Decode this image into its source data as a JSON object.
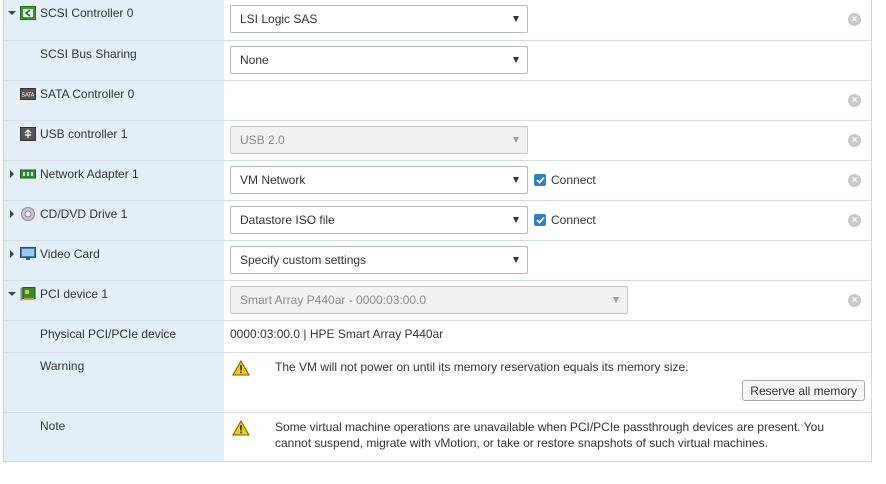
{
  "rows": {
    "scsi": {
      "label": "SCSI Controller 0",
      "value": "LSI Logic SAS"
    },
    "scsi_bus": {
      "label": "SCSI Bus Sharing",
      "value": "None"
    },
    "sata": {
      "label": "SATA Controller 0"
    },
    "usb": {
      "label": "USB controller 1",
      "value": "USB 2.0"
    },
    "net": {
      "label": "Network Adapter 1",
      "value": "VM Network",
      "connect_label": "Connect"
    },
    "cd": {
      "label": "CD/DVD Drive 1",
      "value": "Datastore ISO file",
      "connect_label": "Connect"
    },
    "video": {
      "label": "Video Card",
      "value": "Specify custom settings"
    },
    "pci": {
      "label": "PCI device 1",
      "value": "Smart Array P440ar - 0000:03:00.0"
    },
    "physical": {
      "label": "Physical PCI/PCIe device",
      "value": "0000:03:00.0 | HPE Smart Array P440ar"
    },
    "warning": {
      "label": "Warning",
      "text": "The VM will not power on until its memory reservation equals its memory size.",
      "button": "Reserve all memory"
    },
    "note": {
      "label": "Note",
      "text": "Some virtual machine operations are unavailable when PCI/PCIe passthrough devices are present. You cannot suspend, migrate with vMotion, or take or restore snapshots of such virtual machines."
    }
  },
  "icons": {
    "remove": "remove-circle-icon",
    "expand": "triangle-right-icon",
    "collapse": "triangle-down-icon",
    "warning": "warning-triangle-icon",
    "checkbox": "checkmark-icon"
  },
  "colors": {
    "label_bg": "#e4eef6",
    "check_blue": "#2d7fd0",
    "warning_yellow": "#f5d000"
  }
}
